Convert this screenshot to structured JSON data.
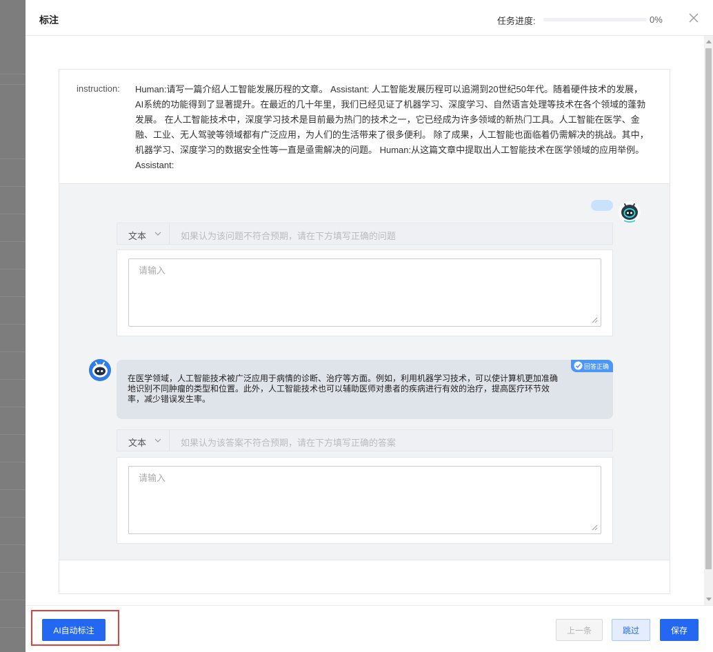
{
  "header": {
    "title": "标注",
    "progress_label": "任务进度:",
    "progress_value": "0%",
    "progress_fraction": 0
  },
  "instruction": {
    "label": "instruction:",
    "text": "Human:请写一篇介绍人工智能发展历程的文章。 Assistant: 人工智能发展历程可以追溯到20世纪50年代。随着硬件技术的发展，AI系统的功能得到了显著提升。在最近的几十年里，我们已经见证了机器学习、深度学习、自然语言处理等技术在各个领域的蓬勃发展。 在人工智能技术中，深度学习技术是目前最为热门的技术之一，它已经成为许多领域的新热门工具。人工智能在医学、金融、工业、无人驾驶等领域都有广泛应用，为人们的生活带来了很多便利。 除了成果，人工智能也面临着仍需解决的挑战。其中，机器学习、深度学习的数据安全性等一直是亟需解决的问题。 Human:从这篇文章中提取出人工智能技术在医学领域的应用举例。 Assistant:"
  },
  "question_section": {
    "type_label": "文本",
    "hint": "如果认为该问题不符合预期，请在下方填写正确的问题",
    "placeholder": "请输入"
  },
  "answer_section": {
    "badge": "回答正确",
    "text": "在医学领域，人工智能技术被广泛应用于病情的诊断、治疗等方面。例如，利用机器学习技术，可以使计算机更加准确地识别不同肿瘤的类型和位置。此外，人工智能技术也可以辅助医师对患者的疾病进行有效的治疗，提高医疗环节效率，减少错误发生率。",
    "type_label": "文本",
    "hint": "如果认为该答案不符合预期，请在下方填写正确的答案",
    "placeholder": "请输入"
  },
  "footer": {
    "ai_label": "AI自动标注",
    "prev_label": "上一条",
    "skip_label": "跳过",
    "save_label": "保存"
  },
  "colors": {
    "primary": "#2468f2",
    "highlight": "#e0403a",
    "answer_bg": "#dfe3ea",
    "badge": "#4c97f5"
  }
}
